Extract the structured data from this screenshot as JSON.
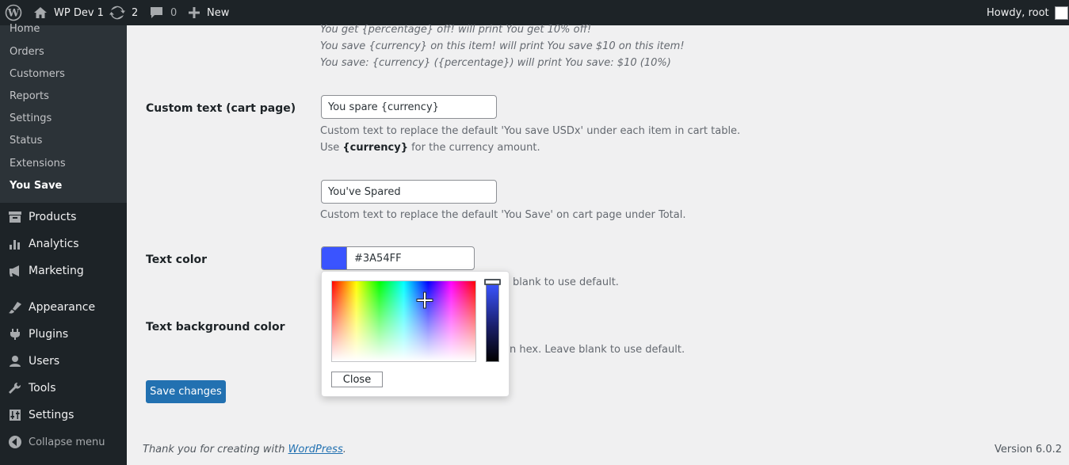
{
  "admin_bar": {
    "site_name": "WP Dev 1",
    "updates_count": "2",
    "comments_count": "0",
    "new_label": "New",
    "howdy": "Howdy, root"
  },
  "sidebar": {
    "submenu": [
      {
        "label": "Home"
      },
      {
        "label": "Orders"
      },
      {
        "label": "Customers"
      },
      {
        "label": "Reports"
      },
      {
        "label": "Settings"
      },
      {
        "label": "Status"
      },
      {
        "label": "Extensions"
      },
      {
        "label": "You Save"
      }
    ],
    "menu": [
      {
        "label": "Products",
        "icon": "products-icon"
      },
      {
        "label": "Analytics",
        "icon": "analytics-icon"
      },
      {
        "label": "Marketing",
        "icon": "marketing-icon"
      },
      {
        "label": "Appearance",
        "icon": "appearance-icon"
      },
      {
        "label": "Plugins",
        "icon": "plugins-icon"
      },
      {
        "label": "Users",
        "icon": "users-icon"
      },
      {
        "label": "Tools",
        "icon": "tools-icon"
      },
      {
        "label": "Settings",
        "icon": "settings-icon"
      }
    ],
    "collapse_label": "Collapse menu"
  },
  "main": {
    "hints": [
      {
        "code": "You get {percentage} off!",
        "mid": " will print ",
        "result": "You get 10% off!"
      },
      {
        "code": "You save {currency} on this item!",
        "mid": " will print ",
        "result": "You save $10 on this item!"
      },
      {
        "code": "You save: {currency} ({percentage})",
        "mid": " will print ",
        "result": "You save: $10 (10%)"
      }
    ],
    "cart_text": {
      "label": "Custom text (cart page)",
      "value": "You spare {currency}",
      "desc_line1": "Custom text to replace the default 'You save USDx' under each item in cart table.",
      "desc_use": "Use ",
      "desc_code": "{currency}",
      "desc_rest": " for the currency amount."
    },
    "total_text": {
      "value": "You've Spared",
      "desc": "Custom text to replace the default 'You Save' on cart page under Total."
    },
    "text_color": {
      "label": "Text color",
      "value": "#3A54FF",
      "swatch_color": "#3a54ff",
      "desc_visible": "blank to use default."
    },
    "text_bg_color": {
      "label": "Text background color",
      "desc_visible": "n hex. Leave blank to use default."
    },
    "picker": {
      "close_label": "Close"
    },
    "save_label": "Save changes"
  },
  "footer": {
    "thanks_prefix": "Thank you for creating with ",
    "thanks_link": "WordPress",
    "thanks_suffix": ".",
    "version": "Version 6.0.2"
  },
  "colors": {
    "admin_bar_bg": "#1d2327",
    "submenu_bg": "#2c3338",
    "primary_button": "#2271b1",
    "page_bg": "#f0f0f1"
  }
}
